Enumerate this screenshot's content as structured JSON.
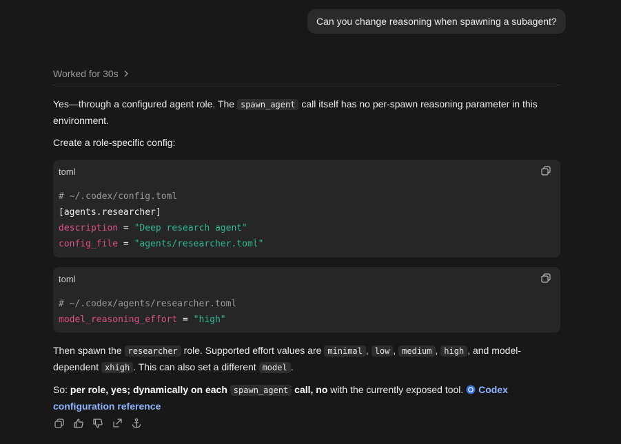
{
  "user_message": "Can you change reasoning when spawning a subagent?",
  "worked_label": "Worked for 30s",
  "para1": {
    "pre": "Yes—through a configured agent role. The",
    "code": "spawn_agent",
    "post": "call itself has no per-spawn reasoning parameter in this environment."
  },
  "para2": "Create a role-specific config:",
  "code_block_1": {
    "lang": "toml",
    "comment": "# ~/.codex/config.toml",
    "section": "[agents.researcher]",
    "k1": "description",
    "eq1": " = ",
    "v1": "\"Deep research agent\"",
    "k2": "config_file",
    "eq2": " = ",
    "v2": "\"agents/researcher.toml\""
  },
  "code_block_2": {
    "lang": "toml",
    "comment": "# ~/.codex/agents/researcher.toml",
    "k1": "model_reasoning_effort",
    "eq1": " = ",
    "v1": "\"high\""
  },
  "para3": {
    "t1": "Then spawn the",
    "c1": "researcher",
    "t2": "role. Supported effort values are",
    "c2": "minimal",
    "t3": ",",
    "c3": "low",
    "t4": ",",
    "c4": "medium",
    "t5": ",",
    "c5": "high",
    "t6": ", and model-dependent",
    "c6": "xhigh",
    "t7": ". This can also set a different",
    "c7": "model",
    "t8": "."
  },
  "para4": {
    "t1": "So:",
    "b1": "per role, yes; dynamically on each",
    "c1": "spawn_agent",
    "b2": "call, no",
    "t2": "with the currently exposed tool.",
    "link": "Codex configuration reference"
  },
  "colors": {
    "background": "#181818",
    "link": "#8fb4ff",
    "toml_key": "#e0508a",
    "toml_string": "#2fb894"
  },
  "actions": [
    "copy-icon",
    "thumbs-up-icon",
    "thumbs-down-icon",
    "share-icon",
    "anchor-icon"
  ]
}
